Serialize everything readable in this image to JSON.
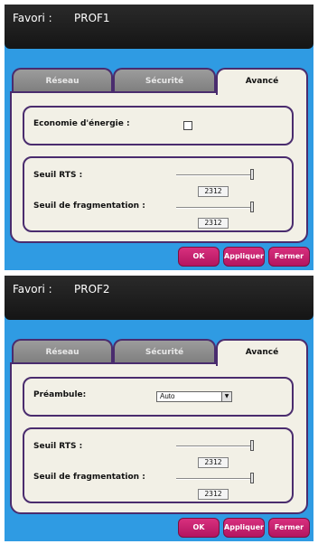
{
  "screens": [
    {
      "title_label": "Favori :",
      "title_value": "PROF1",
      "tabs": [
        "Réseau",
        "Sécurité",
        "Avancé"
      ],
      "option_label": "Economie d'énergie :",
      "option_checked": false,
      "rts_label": "Seuil RTS :",
      "rts_value": "2312",
      "frag_label": "Seuil de fragmentation :",
      "frag_value": "2312",
      "buttons": {
        "ok": "OK",
        "apply": "Appliquer",
        "close": "Fermer"
      }
    },
    {
      "title_label": "Favori :",
      "title_value": "PROF2",
      "tabs": [
        "Réseau",
        "Sécurité",
        "Avancé"
      ],
      "option_label": "Préambule:",
      "option_value": "Auto",
      "rts_label": "Seuil RTS :",
      "rts_value": "2312",
      "frag_label": "Seuil de fragmentation :",
      "frag_value": "2312",
      "buttons": {
        "ok": "OK",
        "apply": "Appliquer",
        "close": "Fermer"
      }
    }
  ]
}
